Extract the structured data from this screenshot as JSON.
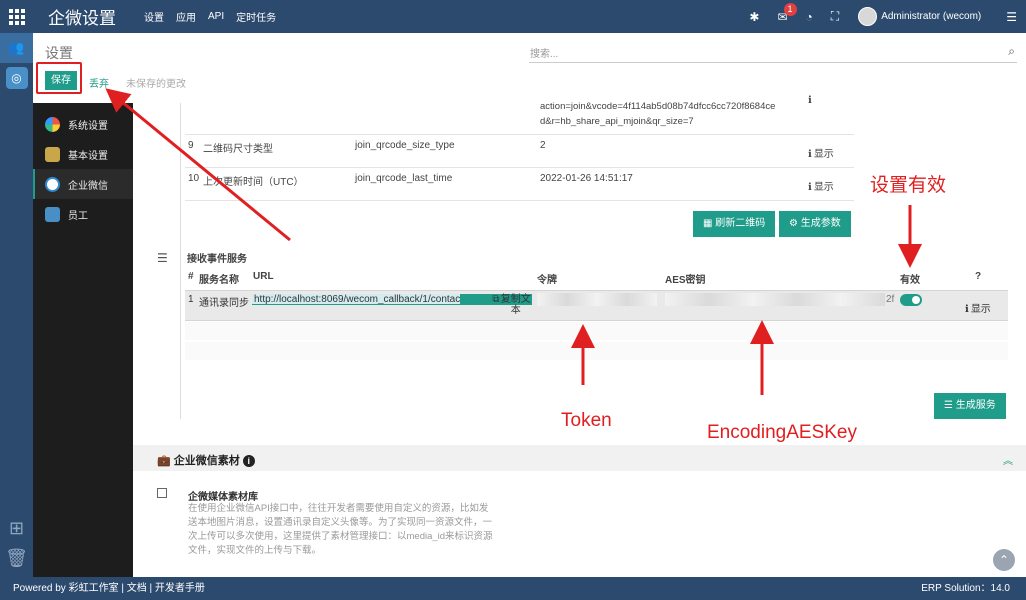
{
  "topbar": {
    "app_title": "企微设置",
    "menu": [
      "设置",
      "应用",
      "API",
      "定时任务"
    ],
    "notification_count": "1",
    "user": "Administrator (wecom)"
  },
  "control": {
    "breadcrumb": "设置",
    "search_placeholder": "搜索...",
    "save_label": "保存",
    "discard_label": "丢弃",
    "unsaved_label": "未保存的更改"
  },
  "sidebar": {
    "items": [
      {
        "label": "系统设置",
        "icon": "color-wheel-icon"
      },
      {
        "label": "基本设置",
        "icon": "gear-icon"
      },
      {
        "label": "企业微信",
        "icon": "chat-icon"
      },
      {
        "label": "员工",
        "icon": "staff-icon"
      }
    ]
  },
  "params_table": {
    "partial_value": [
      "action=join&vcode=4f114ab5d08b74dfcc6cc720f8684ce",
      "d&r=hb_share_api_mjoin&qr_size=7"
    ],
    "rows": [
      {
        "num": "9",
        "name": "二维码尺寸类型",
        "key": "join_qrcode_size_type",
        "value": "2",
        "action": "显示"
      },
      {
        "num": "10",
        "name": "上次更新时间（UTC）",
        "key": "join_qrcode_last_time",
        "value": "2022-01-26 14:51:17",
        "action": "显示"
      }
    ],
    "btn_refresh": "刷新二维码",
    "btn_generate_params": "生成参数"
  },
  "event_service": {
    "title": "接收事件服务",
    "headers": {
      "num": "#",
      "name": "服务名称",
      "url": "URL",
      "token": "令牌",
      "aes": "AES密钥",
      "active": "有效",
      "help": "?"
    },
    "rows": [
      {
        "num": "1",
        "name": "通讯录同步",
        "url": "http://localhost:8069/wecom_callback/1/contacts",
        "copy": "复制文本",
        "token": "",
        "aes_tail": "2f",
        "active": true,
        "action": "显示"
      }
    ],
    "btn_generate_service": "生成服务"
  },
  "material": {
    "title": "企业微信素材",
    "lib_title": "企微媒体素材库",
    "lib_desc": "在使用企业微信API接口中，往往开发者需要使用自定义的资源，比如发送本地图片消息，设置通讯录自定义头像等。为了实现同一资源文件，一次上传可以多次使用，这里提供了素材管理接口：以media_id来标识资源文件，实现文件的上传与下载。"
  },
  "footer": {
    "left": "Powered by 彩虹工作室  |  文档  |  开发者手册",
    "right": "ERP Solution：14.0"
  },
  "annotations": {
    "token": "Token",
    "aes": "EncodingAESKey",
    "active": "设置有效"
  },
  "colors": {
    "primary": "#1f9c8a",
    "nav": "#2c4a6e",
    "annotation": "#e02020"
  }
}
